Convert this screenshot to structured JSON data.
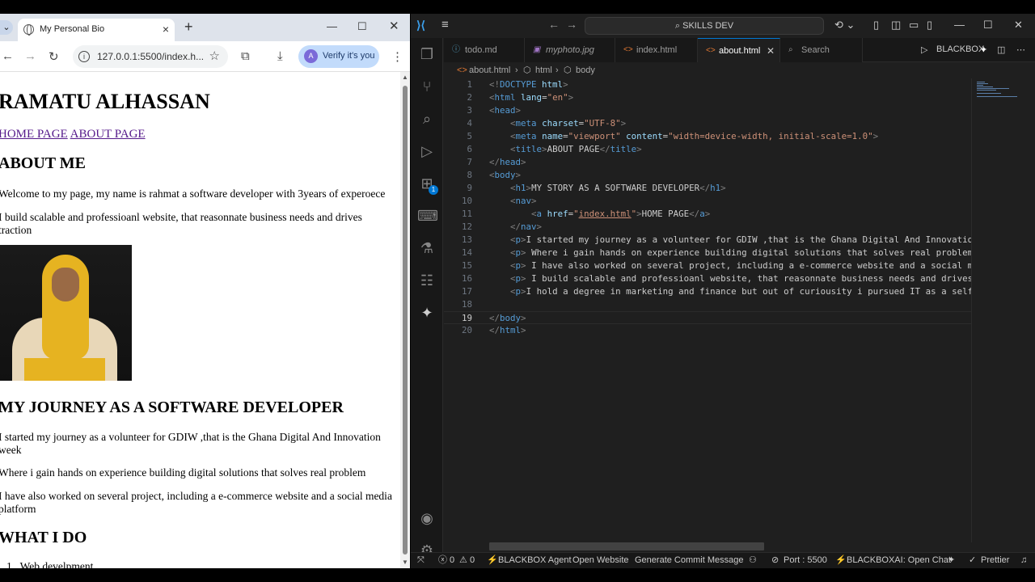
{
  "browser": {
    "tab_title": "My Personal Bio",
    "new_tab": "+",
    "url": "127.0.0.1:5500/index.h...",
    "verify_label": "Verify it's you",
    "page": {
      "title": "RAMATU ALHASSAN",
      "nav": [
        "HOME PAGE",
        "ABOUT PAGE"
      ],
      "about_heading": "ABOUT ME",
      "about_p1": "Welcome to my page, my name is rahmat a software developer with 3years of experoece",
      "about_p2": "I build scalable and professioanl website, that reasonnate business needs and drives traction",
      "journey_heading": "MY JOURNEY AS A SOFTWARE DEVELOPER",
      "journey_p1": "I started my journey as a volunteer for GDIW ,that is the Ghana Digital And Innovation week",
      "journey_p2": "Where i gain hands on experience building digital solutions that solves real problem",
      "journey_p3": "I have also worked on several project, including a e-commerce website and a social media platform",
      "whatido_heading": "WHAT I DO",
      "whatido_item1": "1.  Web develpment"
    }
  },
  "vscode": {
    "search_label": "SKILLS DEV",
    "tabs": [
      {
        "label": "todo.md",
        "icon": "info-icon"
      },
      {
        "label": "myphoto.jpg",
        "icon": "image-icon"
      },
      {
        "label": "index.html",
        "icon": "html-icon"
      },
      {
        "label": "about.html",
        "icon": "html-icon",
        "active": true
      },
      {
        "label": "Search",
        "icon": "search-icon"
      }
    ],
    "blackbox_label": "BLACKBOX",
    "breadcrumbs": [
      "about.html",
      "html",
      "body"
    ],
    "badge_count": "1",
    "line_numbers": [
      "1",
      "2",
      "3",
      "4",
      "5",
      "6",
      "7",
      "8",
      "9",
      "10",
      "11",
      "12",
      "13",
      "14",
      "15",
      "16",
      "17",
      "18",
      "19",
      "20"
    ],
    "current_line": "19",
    "code_text": {
      "l13_text": "I started my journey as a volunteer for GDIW ,that is the Ghana Digital And Innovatio",
      "l14_text": " Where i gain hands on experience building digital solutions that solves real problem",
      "l15_text": " I have also worked on several project, including a e-commerce website and a social m",
      "l16_text": " I build scalable and professioanl website, that reasonnate business needs and drives",
      "l17_text": "I hold a degree in marketing and finance but out of curiousity i pursued IT as a self"
    },
    "status": {
      "errors": "0",
      "warnings": "0",
      "agent": "BLACKBOX Agent",
      "open_website": "Open Website",
      "commit": "Generate Commit Message",
      "port": "Port : 5500",
      "chat": "BLACKBOXAI: Open Chat",
      "prettier": "Prettier"
    }
  }
}
